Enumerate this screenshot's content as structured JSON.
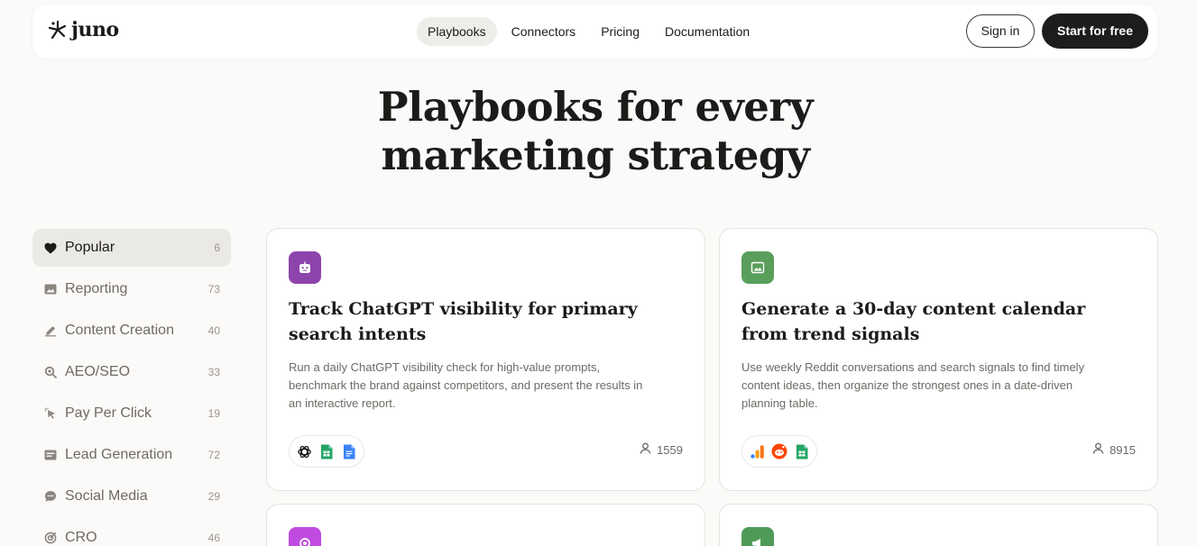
{
  "brand": {
    "name": "juno"
  },
  "nav": {
    "links": [
      {
        "label": "Playbooks",
        "active": true
      },
      {
        "label": "Connectors",
        "active": false
      },
      {
        "label": "Pricing",
        "active": false
      },
      {
        "label": "Documentation",
        "active": false
      }
    ],
    "signin_label": "Sign in",
    "start_label": "Start for free"
  },
  "hero": {
    "line1": "Playbooks for every",
    "line2": "marketing strategy"
  },
  "categories": [
    {
      "label": "Popular",
      "count": "6",
      "icon": "heart-icon",
      "active": true
    },
    {
      "label": "Reporting",
      "count": "73",
      "icon": "image-icon",
      "active": false
    },
    {
      "label": "Content Creation",
      "count": "40",
      "icon": "pencil-icon",
      "active": false
    },
    {
      "label": "AEO/SEO",
      "count": "33",
      "icon": "magnifier-icon",
      "active": false
    },
    {
      "label": "Pay Per Click",
      "count": "19",
      "icon": "cursor-click-icon",
      "active": false
    },
    {
      "label": "Lead Generation",
      "count": "72",
      "icon": "inbox-icon",
      "active": false
    },
    {
      "label": "Social Media",
      "count": "29",
      "icon": "chat-bubble-icon",
      "active": false
    },
    {
      "label": "CRO",
      "count": "46",
      "icon": "target-icon",
      "active": false
    }
  ],
  "cards": [
    {
      "title": "Track ChatGPT visibility for primary search intents",
      "description": "Run a daily ChatGPT visibility check for high-value prompts, benchmark the brand against competitors, and present the results in an interactive report.",
      "users": "1559",
      "badge_color": "#8e44ad",
      "badge_icon": "robot-icon",
      "apps": [
        "openai-icon",
        "google-sheets-icon",
        "google-docs-icon"
      ]
    },
    {
      "title": "Generate a 30-day content calendar from trend signals",
      "description": "Use weekly Reddit conversations and search signals to find timely content ideas, then organize the strongest ones in a date-driven planning table.",
      "users": "8915",
      "badge_color": "#5a9e5b",
      "badge_icon": "image-icon",
      "apps": [
        "google-analytics-icon",
        "reddit-icon",
        "google-sheets-icon"
      ]
    }
  ],
  "partial_cards": [
    {
      "badge_color": "#c04be0",
      "badge_icon": "circle-icon"
    },
    {
      "badge_color": "#4f9a57",
      "badge_icon": "megaphone-icon"
    }
  ]
}
